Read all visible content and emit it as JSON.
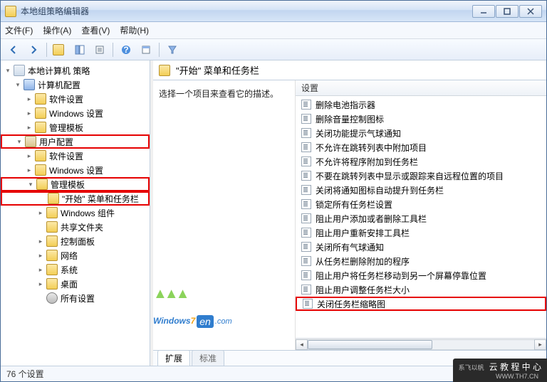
{
  "window": {
    "title": "本地组策略编辑器"
  },
  "menu": {
    "file": "文件(F)",
    "action": "操作(A)",
    "view": "查看(V)",
    "help": "帮助(H)"
  },
  "tree": {
    "root": "本地计算机 策略",
    "computer": "计算机配置",
    "soft1": "软件设置",
    "winset1": "Windows 设置",
    "admintpl1": "管理模板",
    "user": "用户配置",
    "soft2": "软件设置",
    "winset2": "Windows 设置",
    "admintpl2": "管理模板",
    "startmenu": "\"开始\" 菜单和任务栏",
    "wincmp": "Windows 组件",
    "shared": "共享文件夹",
    "ctrlpanel": "控制面板",
    "network": "网络",
    "system": "系统",
    "desktop": "桌面",
    "allset": "所有设置"
  },
  "heading": "\"开始\" 菜单和任务栏",
  "description": "选择一个项目来查看它的描述。",
  "listHeader": "设置",
  "items": [
    "删除电池指示器",
    "删除音量控制图标",
    "关闭功能提示气球通知",
    "不允许在跳转列表中附加项目",
    "不允许将程序附加到任务栏",
    "不要在跳转列表中显示或跟踪来自远程位置的项目",
    "关闭将通知图标自动提升到任务栏",
    "锁定所有任务栏设置",
    "阻止用户添加或者删除工具栏",
    "阻止用户重新安排工具栏",
    "关闭所有气球通知",
    "从任务栏删除附加的程序",
    "阻止用户将任务栏移动到另一个屏幕停靠位置",
    "阻止用户调整任务栏大小",
    "关闭任务栏缩略图"
  ],
  "highlightedItem": 14,
  "tabs": {
    "ext": "扩展",
    "std": "标准"
  },
  "status": "76 个设置",
  "watermark": {
    "prefix": "Windows",
    "seven": "7",
    "en": "en",
    "com": ".com"
  },
  "footer": {
    "small": "系飞以帆",
    "main": "云 教 程 中 心",
    "url": "WWW.TH7.CN"
  }
}
